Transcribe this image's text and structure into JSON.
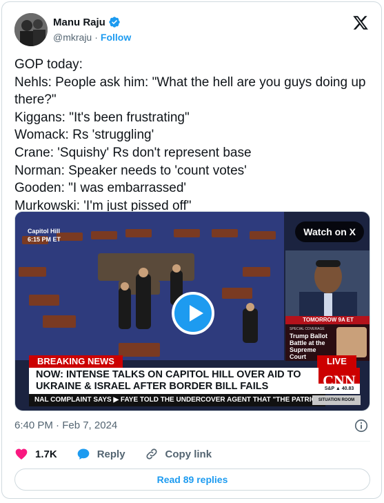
{
  "author": {
    "name": "Manu Raju",
    "handle": "@mkraju",
    "separator": "·",
    "follow_label": "Follow"
  },
  "tweet": {
    "text": "GOP today:\nNehls: People ask him: \"What the hell are you guys doing up there?\"\nKiggans: \"It's been frustrating\"\nWomack: Rs 'struggling'\nCrane: 'Squishy' Rs don't represent base\nNorman: Speaker needs to 'count votes'\nGooden: \"I was embarrassed'\nMurkowski: 'I'm just pissed off\"",
    "timestamp": "6:40 PM · Feb 7, 2024"
  },
  "media": {
    "watch_label": "Watch on X",
    "location_line1": "Capitol Hill",
    "location_line2": "6:15 PM ET",
    "tomorrow": "TOMORROW 9A ET",
    "special_coverage": "SPECIAL COVERAGE",
    "special_title": "Trump Ballot Battle at the Supreme Court",
    "breaking_news": "BREAKING NEWS",
    "live": "LIVE",
    "headline": "NOW: INTENSE TALKS ON CAPITOL HILL OVER AID TO UKRAINE & ISRAEL AFTER BORDER BILL FAILS",
    "network": "CNN",
    "market": "S&P ▲ 40.83",
    "ticker": "NAL COMPLAINT SAYS  ▶  FAYE TOLD THE UNDERCOVER AGENT THAT \"THE PATRIOTS A",
    "show": "SITUATION ROOM"
  },
  "actions": {
    "likes": "1.7K",
    "reply_label": "Reply",
    "copy_label": "Copy link"
  },
  "read_replies_label": "Read 89 replies",
  "colors": {
    "accent": "#1d9bf0",
    "like": "#f91880",
    "breaking": "#cc0000"
  }
}
